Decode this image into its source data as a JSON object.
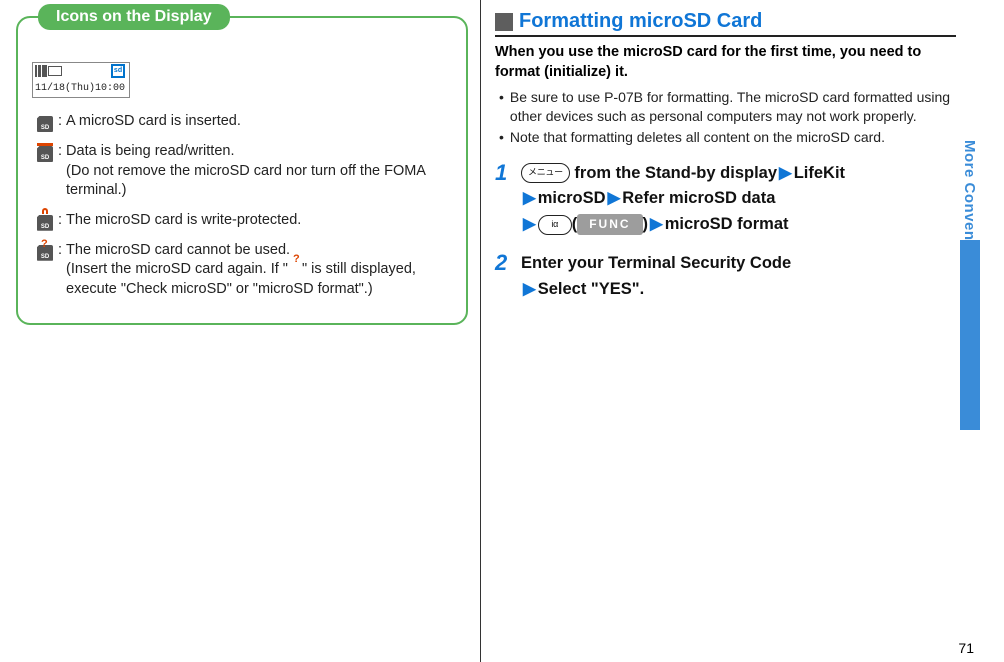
{
  "page_number": "71",
  "side_label": "More Convenient",
  "callout": {
    "title": "Icons on the Display",
    "lcd_date": "11/18(Thu)10:00",
    "items": [
      {
        "desc": "A microSD card is inserted."
      },
      {
        "desc": "Data is being read/written.",
        "sub": "(Do not remove the microSD card nor turn off the FOMA terminal.)"
      },
      {
        "desc": "The microSD card is write-protected."
      },
      {
        "desc": "The microSD card cannot be used.",
        "sub": "(Insert the microSD card again. If \" \" is still displayed, execute \"Check microSD\" or \"microSD format\".)"
      }
    ]
  },
  "section_title": "Formatting microSD Card",
  "intro": "When you use the microSD card for the first time, you need to format (initialize) it.",
  "bullets": [
    "Be sure to use P-07B for formatting. The microSD card formatted using other devices such as personal computers may not work properly.",
    "Note that formatting deletes all content on the microSD card."
  ],
  "step1": {
    "menu_label": "メニュー",
    "text_a": " from the Stand-by display",
    "link_b": "LifeKit",
    "link_c": "microSD",
    "link_d": "Refer microSD data",
    "irda_label": "iα",
    "func_label": "FUNC",
    "link_e": "microSD format"
  },
  "step2": {
    "line1": "Enter your Terminal Security Code",
    "line2": "Select \"YES\"."
  }
}
